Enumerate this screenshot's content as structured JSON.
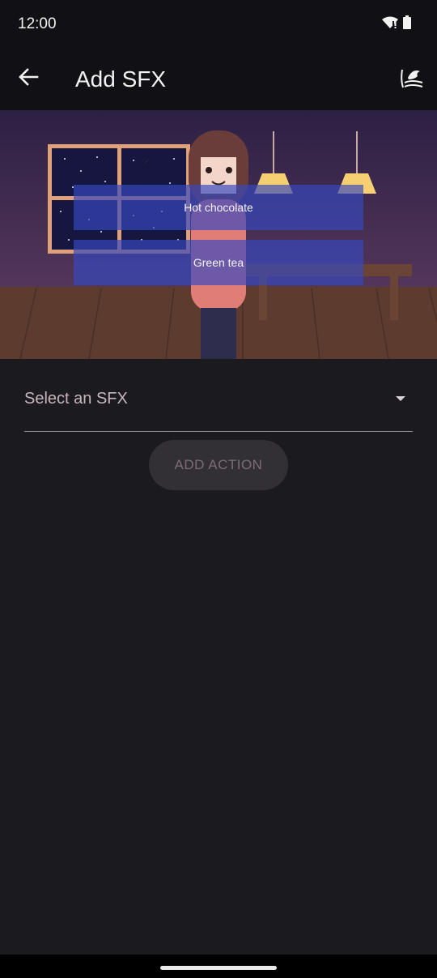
{
  "status_bar": {
    "time": "12:00"
  },
  "app_bar": {
    "title": "Add SFX"
  },
  "scene": {
    "options": [
      "Hot chocolate",
      "Green tea"
    ]
  },
  "form": {
    "select_placeholder": "Select an SFX",
    "add_action_label": "ADD ACTION"
  }
}
